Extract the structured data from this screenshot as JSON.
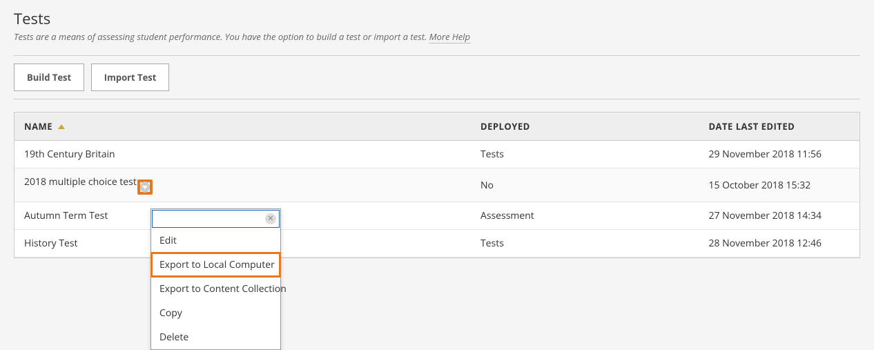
{
  "header": {
    "title": "Tests",
    "description_prefix": "Tests are a means of assessing student performance. You have the option to build a test or import a test. ",
    "more_help": "More Help"
  },
  "actions": {
    "build": "Build Test",
    "import": "Import Test"
  },
  "table": {
    "columns": {
      "name": "NAME",
      "deployed": "DEPLOYED",
      "date": "DATE LAST EDITED"
    },
    "rows": [
      {
        "name": "19th Century Britain",
        "deployed": "Tests",
        "date": "29 November 2018 11:56"
      },
      {
        "name": "2018 multiple choice test",
        "deployed": "No",
        "date": "15 October 2018 15:32"
      },
      {
        "name": "Autumn Term Test",
        "deployed": "Assessment",
        "date": "27 November 2018 14:34"
      },
      {
        "name": "History Test",
        "deployed": "Tests",
        "date": "28 November 2018 12:46"
      }
    ]
  },
  "context_menu": {
    "items": {
      "edit": "Edit",
      "export_local": "Export to Local Computer",
      "export_cc": "Export to Content Collection",
      "copy": "Copy",
      "delete": "Delete"
    }
  },
  "highlights": {
    "row_with_chevron": 1,
    "highlighted_menu_item": "export_local"
  }
}
